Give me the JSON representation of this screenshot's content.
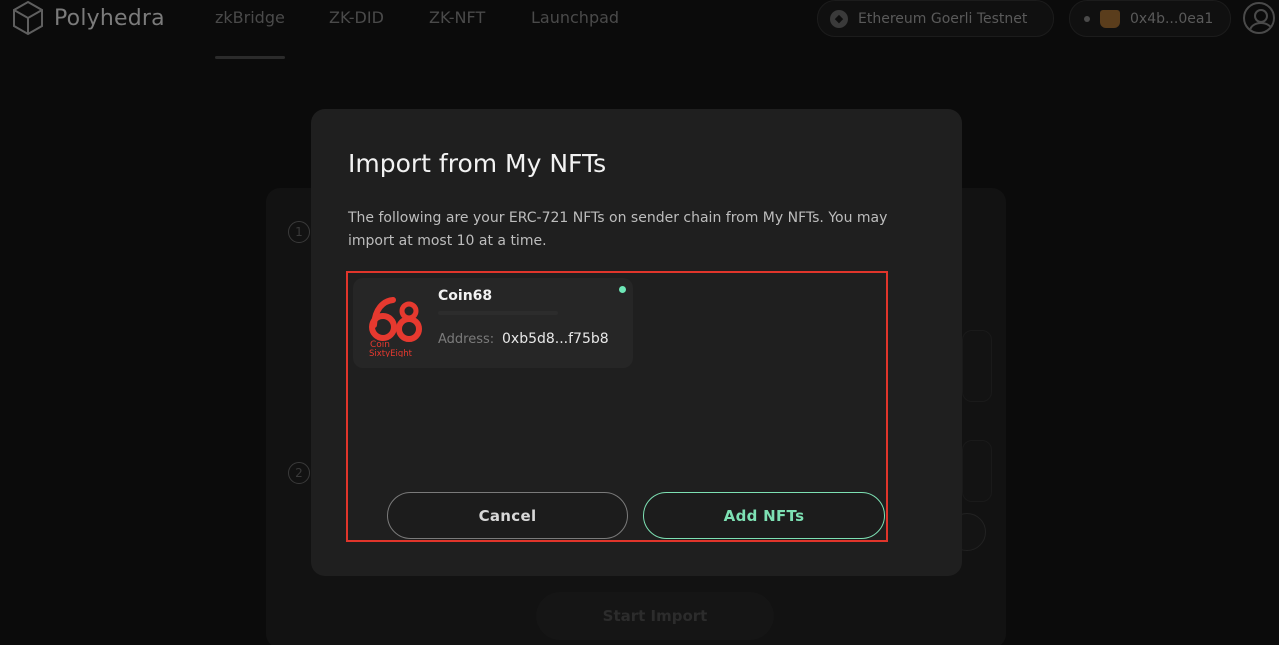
{
  "nav": {
    "brand": "Polyhedra",
    "links": [
      "zkBridge",
      "ZK-DID",
      "ZK-NFT",
      "Launchpad"
    ],
    "network": "Ethereum Goerli Testnet",
    "wallet": "0x4b...0ea1"
  },
  "background": {
    "steps": [
      "1",
      "2"
    ],
    "start_button": "Start Import"
  },
  "modal": {
    "title": "Import from My NFTs",
    "description": "The following are your ERC-721 NFTs on sender chain from My NFTs. You may import at most 10 at a time.",
    "nfts": [
      {
        "name": "Coin68",
        "logo_text": "Coin SixtyEight",
        "address_label": "Address:",
        "address": "0xb5d8...f75b8",
        "selected": true
      }
    ],
    "cancel_label": "Cancel",
    "add_label": "Add NFTs"
  },
  "colors": {
    "accent": "#7de0b3",
    "highlight": "#e0352b",
    "logo": "#e6392f"
  }
}
